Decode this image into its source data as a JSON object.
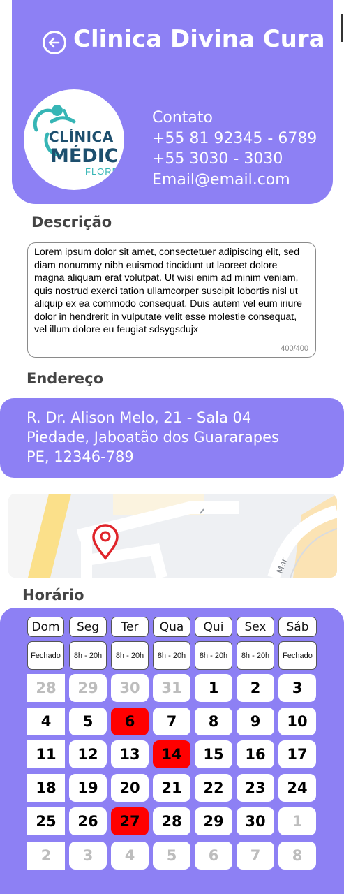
{
  "header": {
    "title": "Clinica Divina Cura",
    "logo_text": [
      "CLÍNICA",
      "MÉDIC",
      "FLORE"
    ]
  },
  "contact": {
    "heading": "Contato",
    "phone_mobile": "+55 81 92345 - 6789",
    "phone_landline": "+55 3030 - 3030",
    "email": "Email@email.com"
  },
  "description": {
    "label": "Descrição",
    "text": "Lorem ipsum dolor sit amet, consectetuer adipiscing elit, sed diam nonummy nibh euismod tincidunt ut laoreet dolore magna aliquam erat volutpat. Ut wisi enim ad minim veniam, quis nostrud exerci tation ullamcorper suscipit lobortis nisl ut aliquip ex ea commodo consequat. Duis autem vel eum iriure dolor in hendrerit in vulputate velit esse molestie consequat, vel illum dolore eu feugiat sdsygsdujx",
    "counter": "400/400"
  },
  "address": {
    "label": "Endereço",
    "line1": "R. Dr. Alison Melo, 21 - Sala 04",
    "line2": "Piedade, Jaboatão dos Guararapes",
    "line3": "PE, 12346-789"
  },
  "map": {
    "street_label": "Mar"
  },
  "schedule": {
    "label": "Horário",
    "days": [
      {
        "name": "Dom",
        "hours": "Fechado"
      },
      {
        "name": "Seg",
        "hours": "8h - 20h"
      },
      {
        "name": "Ter",
        "hours": "8h - 20h"
      },
      {
        "name": "Qua",
        "hours": "8h - 20h"
      },
      {
        "name": "Qui",
        "hours": "8h - 20h"
      },
      {
        "name": "Sex",
        "hours": "8h - 20h"
      },
      {
        "name": "Sáb",
        "hours": "Fechado"
      }
    ],
    "weeks": [
      [
        {
          "d": "28",
          "m": true
        },
        {
          "d": "29",
          "m": true
        },
        {
          "d": "30",
          "m": true
        },
        {
          "d": "31",
          "m": true
        },
        {
          "d": "1"
        },
        {
          "d": "2"
        },
        {
          "d": "3"
        }
      ],
      [
        {
          "d": "4"
        },
        {
          "d": "5"
        },
        {
          "d": "6",
          "h": true
        },
        {
          "d": "7"
        },
        {
          "d": "8"
        },
        {
          "d": "9"
        },
        {
          "d": "10"
        }
      ],
      [
        {
          "d": "11"
        },
        {
          "d": "12"
        },
        {
          "d": "13"
        },
        {
          "d": "14",
          "h": true
        },
        {
          "d": "15"
        },
        {
          "d": "16"
        },
        {
          "d": "17"
        }
      ],
      [
        {
          "d": "18"
        },
        {
          "d": "19"
        },
        {
          "d": "20"
        },
        {
          "d": "21"
        },
        {
          "d": "22"
        },
        {
          "d": "23"
        },
        {
          "d": "24"
        }
      ],
      [
        {
          "d": "25"
        },
        {
          "d": "26"
        },
        {
          "d": "27",
          "h": true
        },
        {
          "d": "28"
        },
        {
          "d": "29"
        },
        {
          "d": "30"
        },
        {
          "d": "1",
          "m": true
        }
      ],
      [
        {
          "d": "2",
          "m": true
        },
        {
          "d": "3",
          "m": true
        },
        {
          "d": "4",
          "m": true
        },
        {
          "d": "5",
          "m": true
        },
        {
          "d": "6",
          "m": true
        },
        {
          "d": "7",
          "m": true
        },
        {
          "d": "8",
          "m": true
        }
      ]
    ],
    "colors": {
      "highlight": "#ff0000",
      "muted": "#bdbdbd",
      "panel": "#8d80f4"
    }
  }
}
